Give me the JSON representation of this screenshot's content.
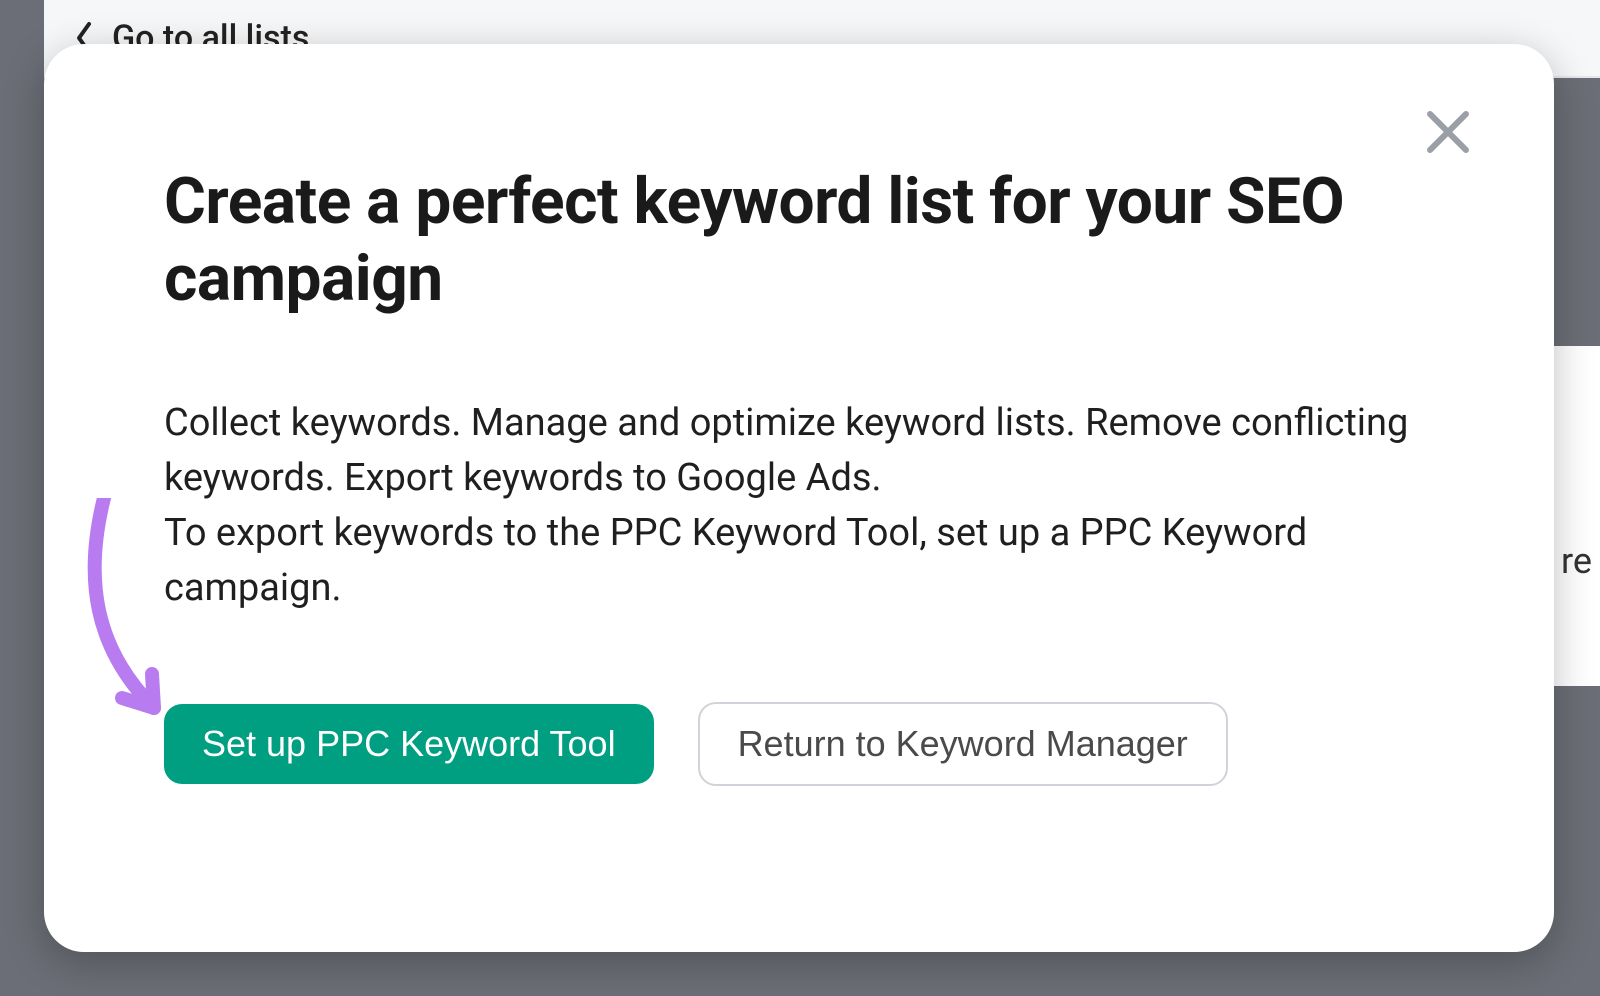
{
  "background": {
    "back_label": "Go to all lists",
    "right_fragment": "re"
  },
  "modal": {
    "title": "Create a perfect keyword list for your SEO campaign",
    "paragraph1": "Collect keywords. Manage and optimize keyword lists. Remove conflicting keywords. Export keywords to Google Ads.",
    "paragraph2": "To export keywords to the PPC Keyword Tool, set up a PPC Keyword campaign.",
    "primary_button": "Set up PPC Keyword Tool",
    "secondary_button": "Return to Keyword Manager"
  }
}
